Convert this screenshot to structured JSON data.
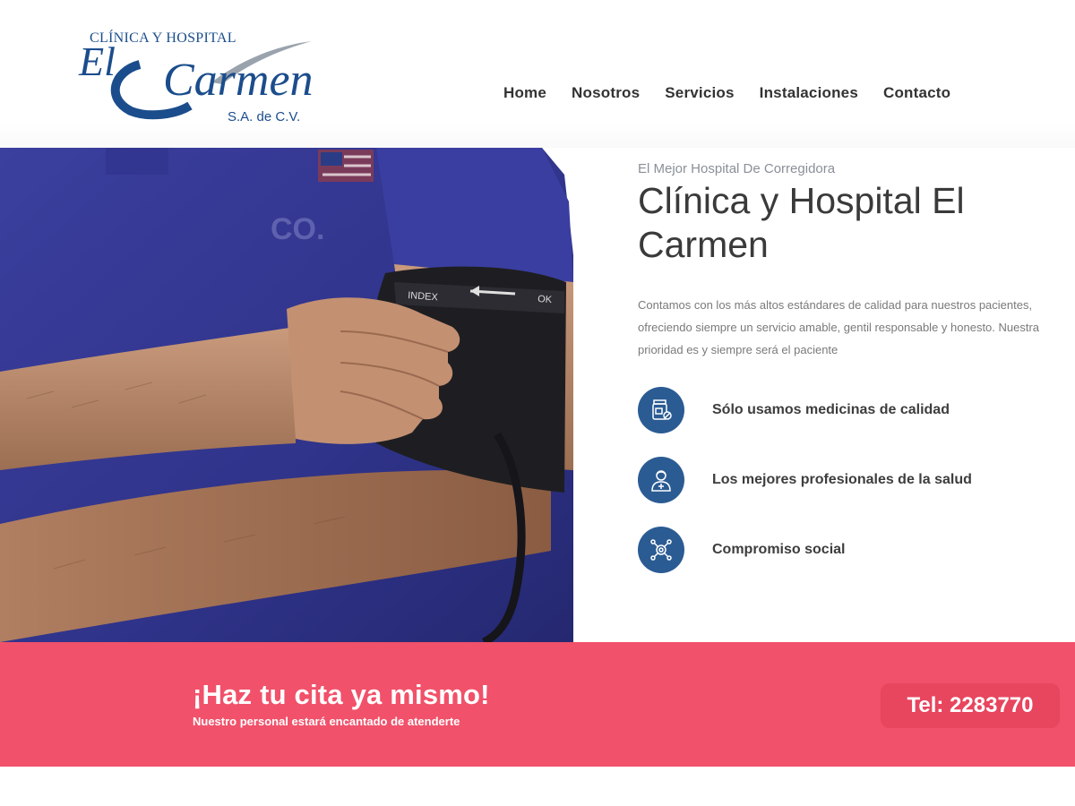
{
  "logo": {
    "line1": "CLÍNICA Y HOSPITAL",
    "el": "El",
    "carmen": "Carmen",
    "suffix": "S.A. de C.V."
  },
  "nav": [
    {
      "label": "Home"
    },
    {
      "label": "Nosotros"
    },
    {
      "label": "Servicios"
    },
    {
      "label": "Instalaciones"
    },
    {
      "label": "Contacto"
    }
  ],
  "hero": {
    "kicker": "El Mejor Hospital De Corregidora",
    "title": "Clínica y Hospital El Carmen",
    "description": "Contamos con los más altos estándares de calidad para nuestros pacientes, ofreciendo siempre un servicio amable, gentil responsable y honesto. Nuestra prioridad es y siempre será el paciente",
    "cuff_label": "INDEX",
    "cuff_ok": "OK"
  },
  "features": [
    {
      "icon": "medicine-bottle-icon",
      "label": "Sólo usamos medicinas de calidad"
    },
    {
      "icon": "doctor-icon",
      "label": "Los mejores profesionales de la salud"
    },
    {
      "icon": "network-icon",
      "label": "Compromiso social"
    }
  ],
  "cta": {
    "title": "¡Haz tu cita ya mismo!",
    "subtitle": "Nuestro personal estará encantado de atenderte",
    "phone": "Tel: 2283770"
  },
  "colors": {
    "brand_blue": "#1b4d8c",
    "icon_blue": "#2b5b93",
    "cta_pink": "#f1516a",
    "button_pink": "#e8455e"
  }
}
